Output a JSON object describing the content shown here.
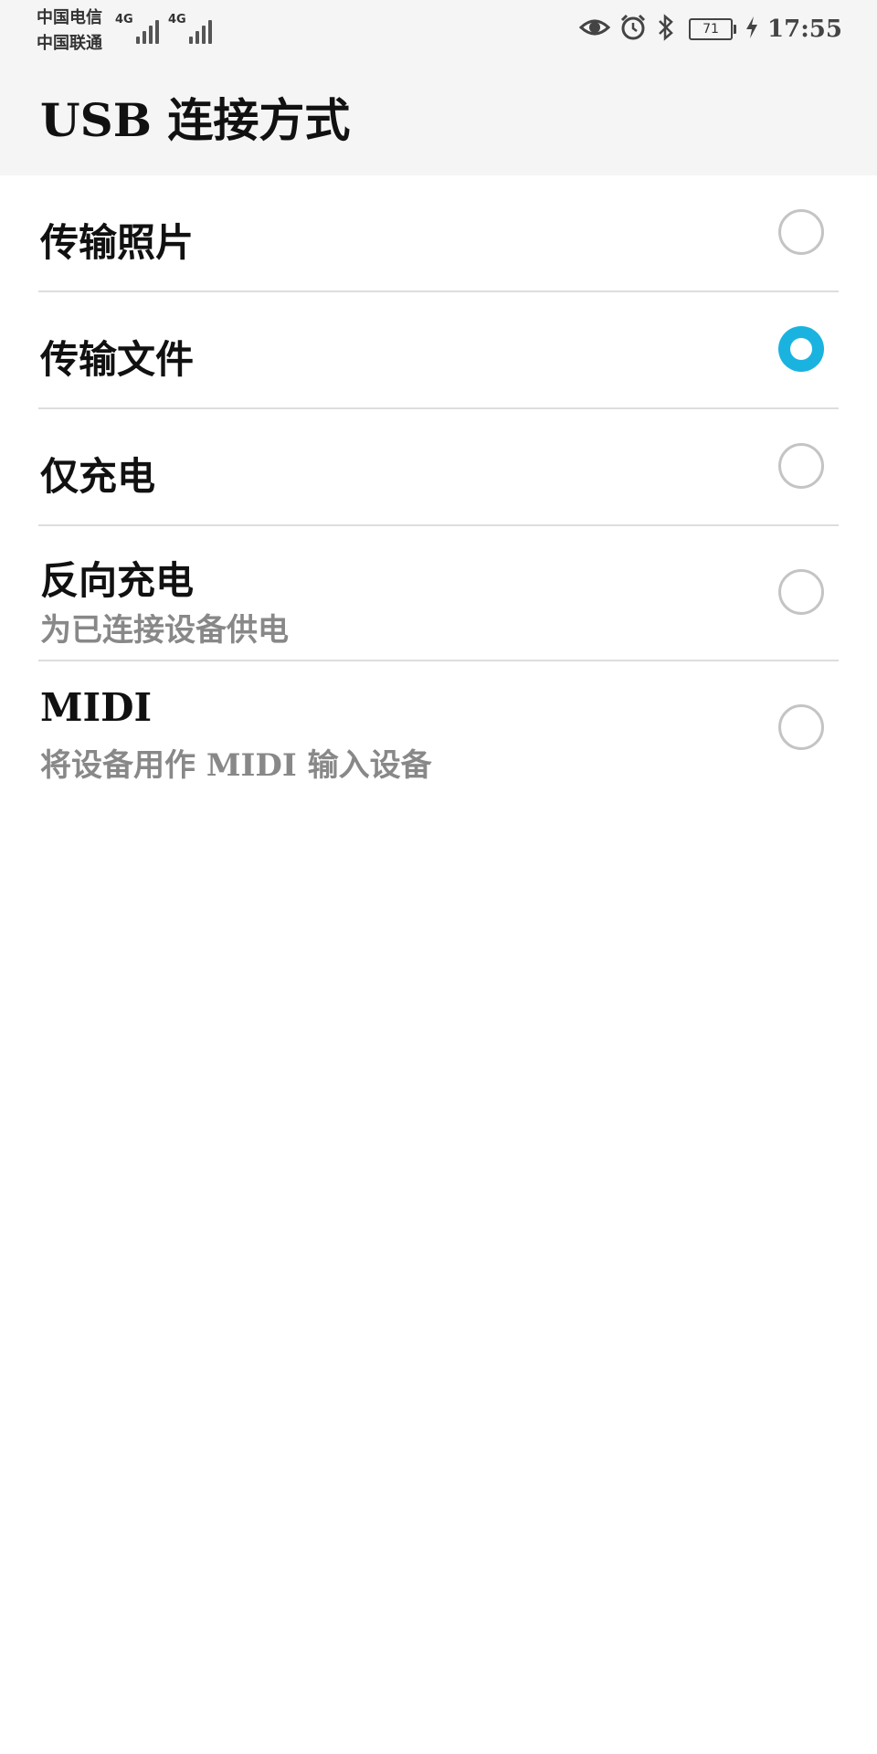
{
  "status_bar": {
    "carrier_1": "中国电信",
    "carrier_2": "中国联通",
    "network_1": "4G",
    "network_2": "4G",
    "battery_level": "71",
    "time": "17:55",
    "icons": [
      "eye-icon",
      "alarm-icon",
      "bluetooth-icon",
      "battery-icon",
      "charging-icon"
    ]
  },
  "header": {
    "title": "USB 连接方式"
  },
  "options": [
    {
      "title": "传输照片",
      "subtitle": "",
      "selected": false
    },
    {
      "title": "传输文件",
      "subtitle": "",
      "selected": true
    },
    {
      "title": "仅充电",
      "subtitle": "",
      "selected": false
    },
    {
      "title": "反向充电",
      "subtitle": "为已连接设备供电",
      "selected": false
    },
    {
      "title": "MIDI",
      "subtitle": "将设备用作 MIDI 输入设备",
      "selected": false
    }
  ],
  "colors": {
    "accent": "#1ab3e0",
    "radio_off": "#c4c4c4",
    "divider": "#dddddd",
    "header_bg": "#f5f5f5"
  }
}
